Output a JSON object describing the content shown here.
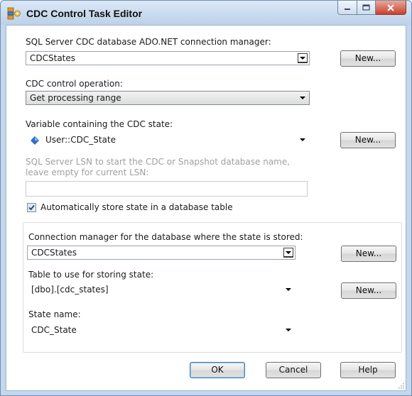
{
  "window": {
    "title": "CDC Control Task Editor",
    "icons": {
      "app": "cdc-task-icon",
      "minimize": "minimize-icon",
      "maximize": "maximize-icon",
      "close": "close-icon"
    }
  },
  "connection_manager": {
    "label": "SQL Server CDC database ADO.NET connection manager:",
    "value": "CDCStates",
    "new_button": "New..."
  },
  "cdc_operation": {
    "label": "CDC control operation:",
    "value": "Get processing range"
  },
  "state_variable": {
    "label": "Variable containing the CDC state:",
    "value": "User::CDC_State",
    "icon": "variable-gem-icon",
    "new_button": "New..."
  },
  "lsn": {
    "label": "SQL Server LSN to start the CDC or Snapshot database name, leave empty for current LSN:",
    "value": ""
  },
  "auto_store": {
    "label": "Automatically store state in a database table",
    "checked": true
  },
  "state_storage": {
    "connection_label": "Connection manager for the database where the state is stored:",
    "connection_value": "CDCStates",
    "connection_new_button": "New...",
    "table_label": "Table to use for storing state:",
    "table_value": "[dbo].[cdc_states]",
    "table_new_button": "New...",
    "state_name_label": "State name:",
    "state_name_value": "CDC_State"
  },
  "footer": {
    "ok": "OK",
    "cancel": "Cancel",
    "help": "Help"
  },
  "colors": {
    "titlebar": "#c4d7ec",
    "close_button": "#c7412c",
    "default_button_border": "#3c7fb1",
    "disabled_text": "#a0a0a0"
  }
}
